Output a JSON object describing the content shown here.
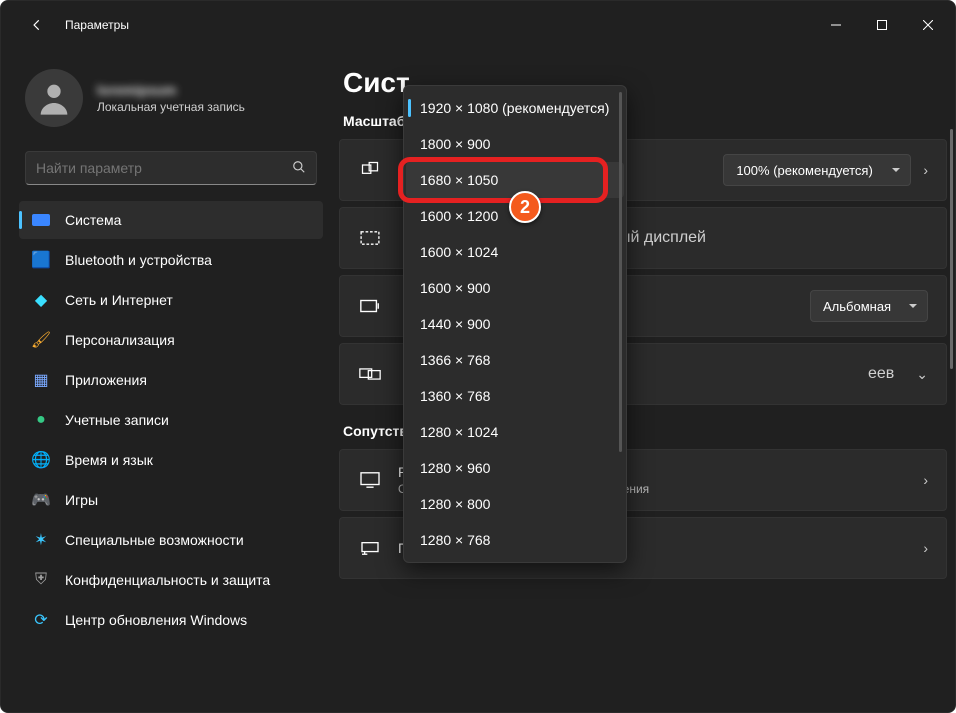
{
  "window_title": "Параметры",
  "user": {
    "name": "loremipsum",
    "subtitle": "Локальная учетная запись"
  },
  "search": {
    "placeholder": "Найти параметр"
  },
  "nav": [
    {
      "label": "Система"
    },
    {
      "label": "Bluetooth и устройства"
    },
    {
      "label": "Сеть и Интернет"
    },
    {
      "label": "Персонализация"
    },
    {
      "label": "Приложения"
    },
    {
      "label": "Учетные записи"
    },
    {
      "label": "Время и язык"
    },
    {
      "label": "Игры"
    },
    {
      "label": "Специальные возможности"
    },
    {
      "label": "Конфиденциальность и защита"
    },
    {
      "label": "Центр обновления Windows"
    }
  ],
  "page": {
    "title_partial": "Сист",
    "section_scale": "Масштаб",
    "section_related_partial": "Сопутств"
  },
  "cards": {
    "scale": {
      "combo": "100% (рекомендуется)"
    },
    "display": {
      "suffix_text": "ый дисплей"
    },
    "orientation": {
      "combo": "Альбомная"
    },
    "multimon": {
      "suffix_text": "еев"
    },
    "advanced": {
      "title": "Расширенные параметры дисплея",
      "sub": "Отображение сведений, частота обновления"
    },
    "graphics": {
      "title": "Графика"
    }
  },
  "dropdown": {
    "items": [
      "1920 × 1080 (рекомендуется)",
      "1800 × 900",
      "1680 × 1050",
      "1600 × 1200",
      "1600 × 1024",
      "1600 × 900",
      "1440 × 900",
      "1366 × 768",
      "1360 × 768",
      "1280 × 1024",
      "1280 × 960",
      "1280 × 800",
      "1280 × 768"
    ],
    "highlighted_index": 2
  },
  "annotation": {
    "badge": "2"
  }
}
